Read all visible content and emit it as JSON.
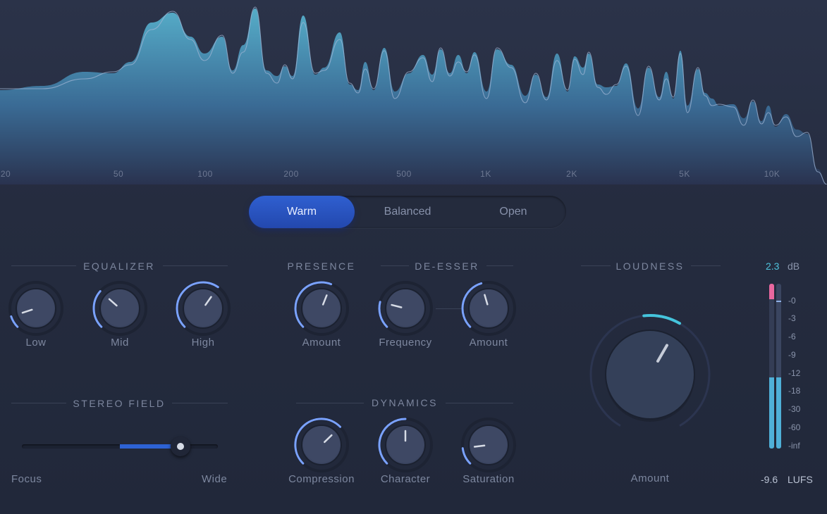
{
  "spectrum": {
    "freq_labels": [
      "20",
      "50",
      "100",
      "200",
      "500",
      "1K",
      "2K",
      "5K",
      "10K"
    ]
  },
  "voicing": {
    "options": [
      "Warm",
      "Balanced",
      "Open"
    ],
    "selected": "Warm"
  },
  "equalizer": {
    "title": "EQUALIZER",
    "knobs": [
      {
        "label": "Low",
        "value": 0.1
      },
      {
        "label": "Mid",
        "value": 0.32
      },
      {
        "label": "High",
        "value": 0.63
      }
    ]
  },
  "presence": {
    "title": "PRESENCE",
    "amount_label": "Amount",
    "value": 0.58
  },
  "deesser": {
    "title": "DE-ESSER",
    "frequency_label": "Frequency",
    "frequency_value": 0.22,
    "amount_label": "Amount",
    "amount_value": 0.44
  },
  "stereo_field": {
    "title": "STEREO FIELD",
    "focus_label": "Focus",
    "wide_label": "Wide",
    "value": 0.81
  },
  "dynamics": {
    "title": "DYNAMICS",
    "knobs": [
      {
        "label": "Compression",
        "value": 0.67
      },
      {
        "label": "Character",
        "value": 0.5
      },
      {
        "label": "Saturation",
        "value": 0.14
      }
    ]
  },
  "loudness": {
    "title": "LOUDNESS",
    "amount_label": "Amount",
    "value": 0.6,
    "peak_db": "2.3",
    "db_unit": "dB",
    "lufs_value": "-9.6",
    "lufs_unit": "LUFS",
    "meter_scale": [
      "-0",
      "-3",
      "-6",
      "-9",
      "-12",
      "-18",
      "-30",
      "-60",
      "-inf"
    ],
    "meter_left_level": 0.43,
    "meter_right_level": 0.43,
    "clip_indicator": true
  },
  "colors": {
    "accent_blue": "#2d62d4",
    "arc_blue": "#7aa2ff",
    "loudness_cyan": "#45c4dc",
    "clip_pink": "#e8679f"
  }
}
